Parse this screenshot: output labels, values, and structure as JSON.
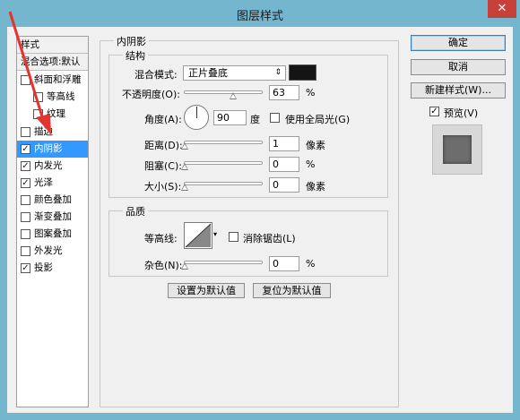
{
  "window": {
    "title": "图层样式",
    "close_label": "✕"
  },
  "sidebar": {
    "header": "样式",
    "blend_options": "混合选项:默认",
    "items": [
      {
        "label": "斜面和浮雕",
        "checked": false
      },
      {
        "label": "等高线",
        "checked": false
      },
      {
        "label": "纹理",
        "checked": false
      },
      {
        "label": "描边",
        "checked": false
      },
      {
        "label": "内阴影",
        "checked": true
      },
      {
        "label": "内发光",
        "checked": true
      },
      {
        "label": "光泽",
        "checked": true
      },
      {
        "label": "颜色叠加",
        "checked": false
      },
      {
        "label": "渐变叠加",
        "checked": false
      },
      {
        "label": "图案叠加",
        "checked": false
      },
      {
        "label": "外发光",
        "checked": false
      },
      {
        "label": "投影",
        "checked": true
      }
    ],
    "check_mark": "✓"
  },
  "panel": {
    "title": "内阴影",
    "structure": {
      "title": "结构",
      "blend_mode_label": "混合模式:",
      "blend_mode_value": "正片叠底",
      "blend_mode_arrow": "⇕",
      "swatch_color": "#141414",
      "opacity_label": "不透明度(O):",
      "opacity_value": "63",
      "opacity_unit": "%",
      "opacity_fraction": 0.63,
      "angle_label": "角度(A):",
      "angle_value": "90",
      "angle_unit": "度",
      "global_light_label": "使用全局光(G)",
      "global_light_checked": false,
      "distance_label": "距离(D):",
      "distance_value": "1",
      "distance_unit": "像素",
      "choke_label": "阻塞(C):",
      "choke_value": "0",
      "choke_unit": "%",
      "size_label": "大小(S):",
      "size_value": "0",
      "size_unit": "像素"
    },
    "quality": {
      "title": "品质",
      "contour_label": "等高线:",
      "antialias_label": "消除锯齿(L)",
      "antialias_checked": false,
      "noise_label": "杂色(N):",
      "noise_value": "0",
      "noise_unit": "%"
    },
    "set_default_button": "设置为默认值",
    "reset_default_button": "复位为默认值"
  },
  "actions": {
    "ok_button": "确定",
    "cancel_button": "取消",
    "new_style_button": "新建样式(W)...",
    "preview_label": "预览(V)",
    "preview_checked": true
  },
  "colors": {
    "selection": "#3399ff",
    "window_frame": "#74b6ce",
    "annotation_arrow": "#e3342f"
  }
}
